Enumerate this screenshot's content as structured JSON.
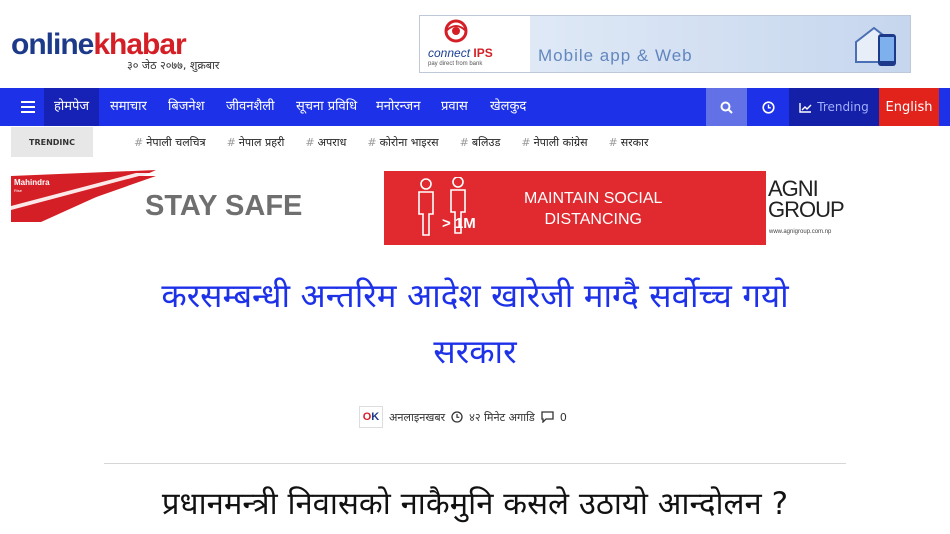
{
  "brand": {
    "logo_part1": "online",
    "logo_part2": "khabar",
    "date": "३० जेठ २०७७, शुक्रबार"
  },
  "top_ad": {
    "brand": "connect",
    "brand_bold": "IPS",
    "tagline": "pay direct from bank",
    "headline": "Mobile app & Web"
  },
  "nav": {
    "items": [
      {
        "label": "होमपेज",
        "active": true
      },
      {
        "label": "समाचार"
      },
      {
        "label": "बिजनेश"
      },
      {
        "label": "जीवनशैली"
      },
      {
        "label": "सूचना प्रविधि"
      },
      {
        "label": "मनोरन्जन"
      },
      {
        "label": "प्रवास"
      },
      {
        "label": "खेलकुद"
      }
    ],
    "trending_label": "Trending",
    "english_label": "English"
  },
  "trending": {
    "label": "TRENDINC",
    "tags": [
      "नेपाली चलचित्र",
      "नेपाल प्रहरी",
      "अपराध",
      "कोरोना भाइरस",
      "बलिउड",
      "नेपाली कांग्रेस",
      "सरकार"
    ]
  },
  "banner_ad": {
    "mahindra": "Mahindra",
    "mahindra_sub": "Rise",
    "stay_safe": "STAY SAFE",
    "message_line1": "MAINTAIN SOCIAL",
    "message_line2": "DISTANCING",
    "distance": "> 1M",
    "agni_line1": "AGNI",
    "agni_line2": "GROUP",
    "agni_url": "www.agnigroup.com.np"
  },
  "article": {
    "headline_line1": "करसम्बन्धी अन्तरिम आदेश खारेजी माग्दै सर्वोच्च गयो",
    "headline_line2": "सरकार",
    "author": "अनलाइनखबर",
    "time_ago": "४२ मिनेट अगाडि",
    "comment_count": "0",
    "author_logo_o": "O",
    "author_logo_k": "K"
  },
  "next_article": {
    "headline": "प्रधानमन्त्री निवासको नाकैमुनि कसले उठायो आन्दोलन ?"
  },
  "colors": {
    "nav_bg": "#1d32e8",
    "headline": "#1d32e8",
    "english_bg": "#e1231c",
    "brand_blue": "#1d3a8a",
    "brand_red": "#d51f26"
  },
  "icons": [
    "menu-icon",
    "search-icon",
    "clock-icon",
    "trending-chart-icon",
    "comment-icon"
  ]
}
